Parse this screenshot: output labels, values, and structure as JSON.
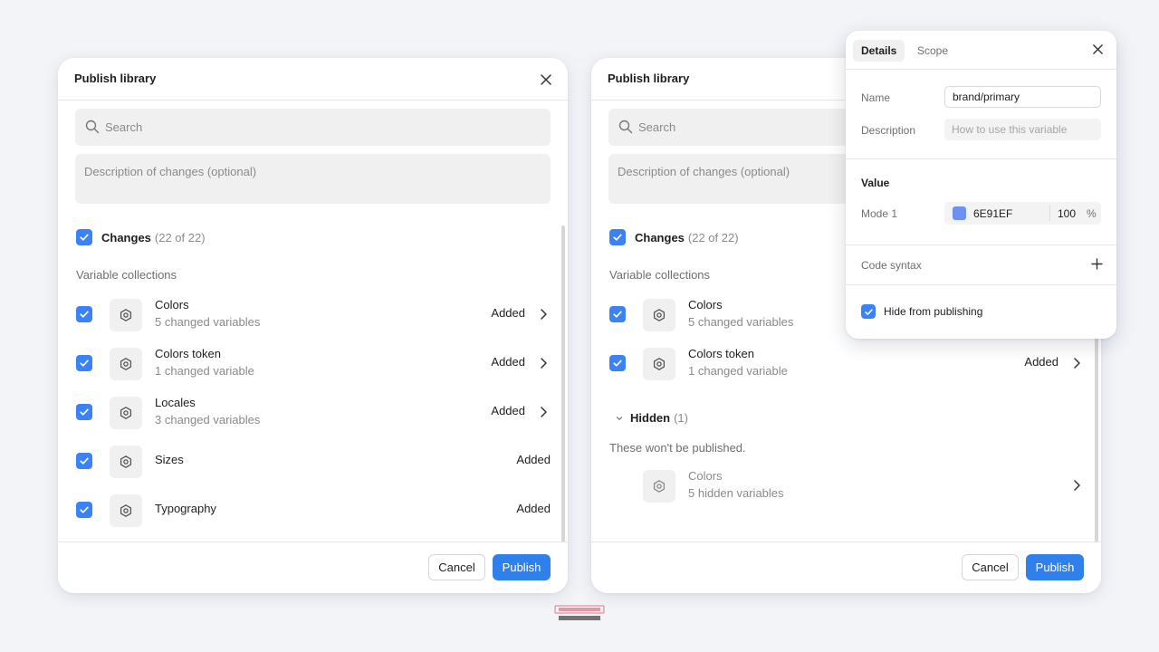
{
  "left_dialog": {
    "title": "Publish library",
    "search_placeholder": "Search",
    "description_placeholder": "Description of changes (optional)",
    "changes_label": "Changes",
    "changes_count": "(22 of 22)",
    "section_label": "Variable collections",
    "collections": [
      {
        "name": "Colors",
        "sub": "5 changed variables",
        "status": "Added",
        "has_chevron": true
      },
      {
        "name": "Colors token",
        "sub": "1 changed variable",
        "status": "Added",
        "has_chevron": true
      },
      {
        "name": "Locales",
        "sub": "3 changed variables",
        "status": "Added",
        "has_chevron": true
      },
      {
        "name": "Sizes",
        "sub": "",
        "status": "Added",
        "has_chevron": false
      },
      {
        "name": "Typography",
        "sub": "",
        "status": "Added",
        "has_chevron": false
      }
    ],
    "cancel_label": "Cancel",
    "publish_label": "Publish"
  },
  "right_dialog": {
    "title": "Publish library",
    "search_placeholder": "Search",
    "description_placeholder": "Description of changes (optional)",
    "changes_label": "Changes",
    "changes_count": "(22 of 22)",
    "section_label": "Variable collections",
    "collections": [
      {
        "name": "Colors",
        "sub": "5 changed variables"
      },
      {
        "name": "Colors token",
        "sub": "1 changed variable",
        "status": "Added"
      }
    ],
    "hidden_label": "Hidden",
    "hidden_count": "(1)",
    "hidden_note": "These won't be published.",
    "hidden_collection": {
      "name": "Colors",
      "sub": "5 hidden variables"
    },
    "cancel_label": "Cancel",
    "publish_label": "Publish"
  },
  "details_popover": {
    "tab_details": "Details",
    "tab_scope": "Scope",
    "name_label": "Name",
    "name_value": "brand/primary",
    "description_label": "Description",
    "description_placeholder": "How to use this variable",
    "value_heading": "Value",
    "mode_label": "Mode 1",
    "hex_value": "6E91EF",
    "opacity_value": "100",
    "opacity_unit": "%",
    "code_syntax_label": "Code syntax",
    "hide_label": "Hide from publishing"
  },
  "colors": {
    "accent": "#2f80ed",
    "checkbox": "#3b82f6",
    "swatch": "#6e91ef",
    "background": "#f2f4f8"
  },
  "icons": [
    "search-icon",
    "close-icon",
    "collection-icon",
    "chevron-right-icon",
    "chevron-down-icon",
    "plus-icon",
    "check-icon"
  ]
}
